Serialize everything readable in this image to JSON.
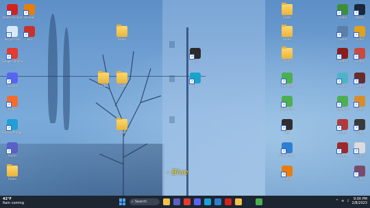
{
  "wallpaper": {
    "caption": "- Blue"
  },
  "desktop_icons": [
    {
      "id": "adobe",
      "label": "Adobe Acrobat",
      "icon": "acrobat-icon",
      "color": "#d4221c"
    },
    {
      "id": "blender1",
      "label": "Blender",
      "icon": "blender-icon",
      "color": "#e87d0d"
    },
    {
      "id": "recycle",
      "label": "Recycle Bin",
      "icon": "recycle-bin-icon",
      "color": "#d9e9f7"
    },
    {
      "id": "tool",
      "label": "Tool",
      "icon": "app-icon",
      "color": "#c7322b"
    },
    {
      "id": "chrome",
      "label": "Google Chrome",
      "icon": "chrome-icon",
      "color": "#e33b2e"
    },
    {
      "id": "discord",
      "label": "Discord",
      "icon": "discord-icon",
      "color": "#5865f2"
    },
    {
      "id": "origin",
      "label": "Origin",
      "icon": "origin-icon",
      "color": "#f56c2d"
    },
    {
      "id": "edge",
      "label": "Microsoft Edge",
      "icon": "edge-icon",
      "color": "#1f9fd6"
    },
    {
      "id": "teams",
      "label": "Teams",
      "icon": "teams-icon",
      "color": "#5b5fc7"
    },
    {
      "id": "folder-left",
      "label": "Folder",
      "icon": "folder-icon",
      "color": "#f2c14e"
    },
    {
      "id": "folder-a",
      "label": "Folder",
      "icon": "folder-icon",
      "color": "#f2c14e"
    },
    {
      "id": "folder-b",
      "label": "Folder",
      "icon": "folder-icon",
      "color": "#f2c14e"
    },
    {
      "id": "folder-c",
      "label": "Folder",
      "icon": "folder-icon",
      "color": "#f2c14e"
    },
    {
      "id": "folder-d",
      "label": "Folder",
      "icon": "folder-icon",
      "color": "#f2c14e"
    },
    {
      "id": "ds",
      "label": "DS",
      "icon": "app-icon",
      "color": "#2b2b2b"
    },
    {
      "id": "pc",
      "label": "PC",
      "icon": "app-icon",
      "color": "#1aa3c9"
    },
    {
      "id": "folder-r1",
      "label": "Folder",
      "icon": "folder-icon",
      "color": "#f2c14e"
    },
    {
      "id": "folder-r2",
      "label": "Folder",
      "icon": "folder-icon",
      "color": "#f2c14e"
    },
    {
      "id": "folder-r3",
      "label": "Folder",
      "icon": "folder-icon",
      "color": "#f2c14e"
    },
    {
      "id": "sims1",
      "label": "The Sims",
      "icon": "sims-icon",
      "color": "#4caf50"
    },
    {
      "id": "sims2",
      "label": "The Sims",
      "icon": "sims-icon",
      "color": "#4caf50"
    },
    {
      "id": "obs",
      "label": "OBS",
      "icon": "obs-icon",
      "color": "#302e31"
    },
    {
      "id": "sims4",
      "label": "The Sims 4",
      "icon": "sims-icon",
      "color": "#2f7fd1"
    },
    {
      "id": "blender2",
      "label": "Blender",
      "icon": "blender-icon",
      "color": "#e87d0d"
    },
    {
      "id": "game1",
      "label": "Game",
      "icon": "game-icon",
      "color": "#3e8e3a"
    },
    {
      "id": "steam",
      "label": "Steam",
      "icon": "steam-icon",
      "color": "#1b2838"
    },
    {
      "id": "game2",
      "label": "Game",
      "icon": "game-icon",
      "color": "#5a7fa8"
    },
    {
      "id": "game3",
      "label": "Game",
      "icon": "game-icon",
      "color": "#e0a21b"
    },
    {
      "id": "game4",
      "label": "Game",
      "icon": "game-icon",
      "color": "#8b1c1c"
    },
    {
      "id": "game5",
      "label": "Game",
      "icon": "game-icon",
      "color": "#c94a3d"
    },
    {
      "id": "game6",
      "label": "Game",
      "icon": "game-icon",
      "color": "#4fb3c7"
    },
    {
      "id": "game7",
      "label": "Game",
      "icon": "game-icon",
      "color": "#6b2b2b"
    },
    {
      "id": "sims5",
      "label": "The Sims",
      "icon": "sims-icon",
      "color": "#4caf50"
    },
    {
      "id": "game8",
      "label": "Game",
      "icon": "game-icon",
      "color": "#d98c2b"
    },
    {
      "id": "game9",
      "label": "Game",
      "icon": "game-icon",
      "color": "#b23a3a"
    },
    {
      "id": "game10",
      "label": "Game",
      "icon": "game-icon",
      "color": "#3a3a3a"
    },
    {
      "id": "game11",
      "label": "Game",
      "icon": "game-icon",
      "color": "#a12828"
    },
    {
      "id": "game12",
      "label": "Game",
      "icon": "game-icon",
      "color": "#dcdcdc"
    },
    {
      "id": "game13",
      "label": "Game",
      "icon": "game-icon",
      "color": "#7a4a6b"
    }
  ],
  "taskbar": {
    "weather": {
      "temp": "42°F",
      "condition": "Rain coming"
    },
    "search_label": "Search",
    "time": "9:00 PM",
    "date": "2/8/2023",
    "accent": "#4ea3ff",
    "pinned": [
      {
        "name": "file-explorer-icon",
        "color": "#f2c14e"
      },
      {
        "name": "chat-icon",
        "color": "#5b5fc7"
      },
      {
        "name": "chrome-icon",
        "color": "#e33b2e"
      },
      {
        "name": "discord-icon",
        "color": "#5865f2"
      },
      {
        "name": "edge-icon",
        "color": "#1f9fd6"
      },
      {
        "name": "store-icon",
        "color": "#2f7fd1"
      },
      {
        "name": "mail-icon",
        "color": "#d4221c"
      },
      {
        "name": "folder-icon",
        "color": "#f2c14e"
      },
      {
        "name": "steam-icon",
        "color": "#1b2838"
      },
      {
        "name": "sims-icon",
        "color": "#4caf50"
      }
    ]
  }
}
